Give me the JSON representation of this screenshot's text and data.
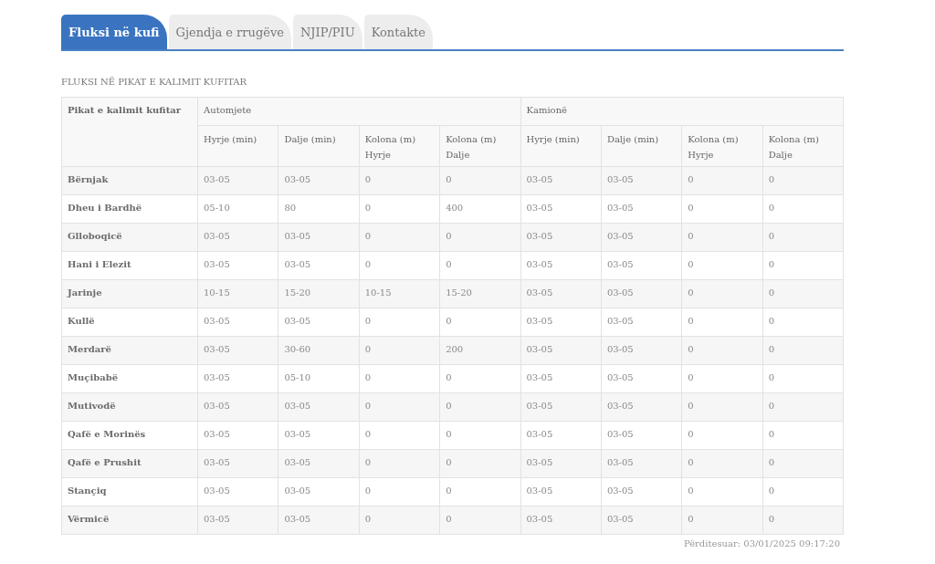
{
  "tabs": [
    {
      "label": "Fluksi në kufi",
      "selected": true
    },
    {
      "label": "Gjendja e rrugëve",
      "selected": false
    },
    {
      "label": "NJIP/PIU",
      "selected": false
    },
    {
      "label": "Kontakte",
      "selected": false
    }
  ],
  "section_title": "FLUKSI NË PIKAT E KALIMIT KUFITAR",
  "table": {
    "row_header": "Pikat e kalimit kufitar",
    "groups": [
      {
        "label": "Automjete",
        "columns": [
          "Hyrje (min)",
          "Dalje (min)",
          "Kolona (m) Hyrje",
          "Kolona (m) Dalje"
        ]
      },
      {
        "label": "Kamionë",
        "columns": [
          "Hyrje (min)",
          "Dalje (min)",
          "Kolona (m) Hyrje",
          "Kolona (m) Dalje"
        ]
      }
    ],
    "rows": [
      {
        "name": "Bërnjak",
        "cells": [
          "03-05",
          "03-05",
          "0",
          "0",
          "03-05",
          "03-05",
          "0",
          "0"
        ]
      },
      {
        "name": "Dheu i Bardhë",
        "cells": [
          "05-10",
          "80",
          "0",
          "400",
          "03-05",
          "03-05",
          "0",
          "0"
        ]
      },
      {
        "name": "Glloboqicë",
        "cells": [
          "03-05",
          "03-05",
          "0",
          "0",
          "03-05",
          "03-05",
          "0",
          "0"
        ]
      },
      {
        "name": "Hani i Elezit",
        "cells": [
          "03-05",
          "03-05",
          "0",
          "0",
          "03-05",
          "03-05",
          "0",
          "0"
        ]
      },
      {
        "name": "Jarinje",
        "cells": [
          "10-15",
          "15-20",
          "10-15",
          "15-20",
          "03-05",
          "03-05",
          "0",
          "0"
        ]
      },
      {
        "name": "Kullë",
        "cells": [
          "03-05",
          "03-05",
          "0",
          "0",
          "03-05",
          "03-05",
          "0",
          "0"
        ]
      },
      {
        "name": "Merdarë",
        "cells": [
          "03-05",
          "30-60",
          "0",
          "200",
          "03-05",
          "03-05",
          "0",
          "0"
        ]
      },
      {
        "name": "Muçibabë",
        "cells": [
          "03-05",
          "05-10",
          "0",
          "0",
          "03-05",
          "03-05",
          "0",
          "0"
        ]
      },
      {
        "name": "Mutivodë",
        "cells": [
          "03-05",
          "03-05",
          "0",
          "0",
          "03-05",
          "03-05",
          "0",
          "0"
        ]
      },
      {
        "name": "Qafë e Morinës",
        "cells": [
          "03-05",
          "03-05",
          "0",
          "0",
          "03-05",
          "03-05",
          "0",
          "0"
        ]
      },
      {
        "name": "Qafë e Prushit",
        "cells": [
          "03-05",
          "03-05",
          "0",
          "0",
          "03-05",
          "03-05",
          "0",
          "0"
        ]
      },
      {
        "name": "Stançiq",
        "cells": [
          "03-05",
          "03-05",
          "0",
          "0",
          "03-05",
          "03-05",
          "0",
          "0"
        ]
      },
      {
        "name": "Vërmicë",
        "cells": [
          "03-05",
          "03-05",
          "0",
          "0",
          "03-05",
          "03-05",
          "0",
          "0"
        ]
      }
    ]
  },
  "updated": "Përditesuar: 03/01/2025 09:17:20"
}
